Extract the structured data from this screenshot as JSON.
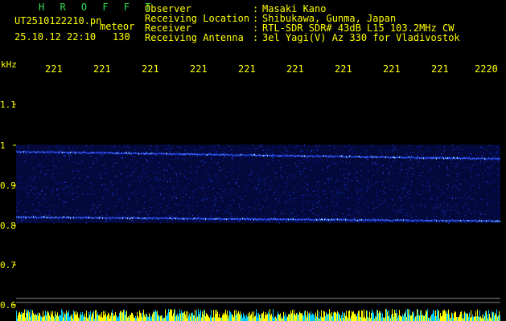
{
  "header": {
    "logo": "H R O F F T",
    "file_name": "UT2510122210.pn",
    "mode": "meteor",
    "datetime": "25.10.12 22:10",
    "count": "130",
    "fields": [
      {
        "label": "Observer",
        "sep": ":",
        "value": "Masaki Kano"
      },
      {
        "label": "Receiving Location",
        "sep": ":",
        "value": "Shibukawa, Gunma, Japan"
      },
      {
        "label": "Receiver",
        "sep": ":",
        "value": "RTL-SDR SDR# 43dB L15 103.2MHz CW"
      },
      {
        "label": "Receiving Antenna",
        "sep": ":",
        "value": "3el Yagi(V) Az 330 for Vladivostok"
      }
    ]
  },
  "axis": {
    "y_unit": "kHz",
    "y_ticks": [
      "1.1",
      "1",
      "0.9",
      "0.8",
      "0.7",
      "0.6"
    ],
    "x_ticks": [
      "221",
      "221",
      "221",
      "221",
      "221",
      "221",
      "221",
      "221",
      "221",
      "2220"
    ]
  },
  "spectrogram": {
    "upper_trace_khz": 0.98,
    "lower_trace_khz": 0.82,
    "baseline_khz": 0.61,
    "colors": {
      "background": "#000000",
      "trace": "#2a4cff",
      "noise": "#0a1fb0",
      "level": "#ffff00",
      "level_alt": "#00ccff"
    }
  }
}
